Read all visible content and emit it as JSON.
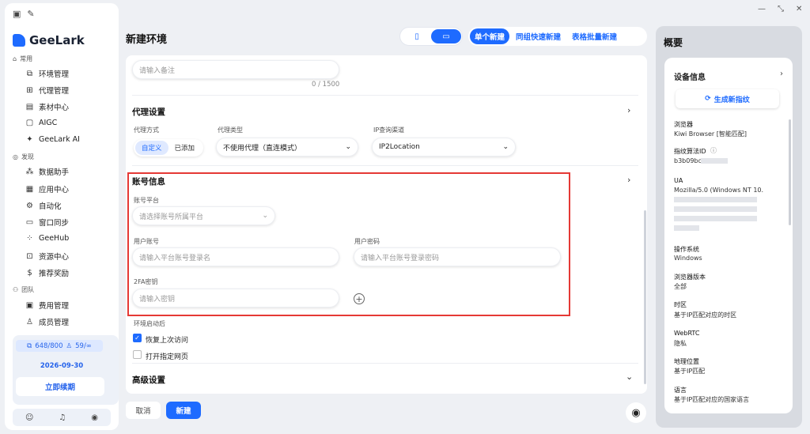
{
  "app": {
    "name": "GeeLark"
  },
  "sidebar": {
    "sections": [
      {
        "label": "常用",
        "items": [
          {
            "label": "环境管理",
            "icon": "environment-icon"
          },
          {
            "label": "代理管理",
            "icon": "proxy-icon"
          },
          {
            "label": "素材中心",
            "icon": "material-icon"
          },
          {
            "label": "AIGC",
            "icon": "aigc-icon"
          },
          {
            "label": "GeeLark AI",
            "icon": "ai-icon"
          }
        ]
      },
      {
        "label": "发现",
        "items": [
          {
            "label": "数据助手",
            "icon": "data-icon"
          },
          {
            "label": "应用中心",
            "icon": "apps-icon"
          },
          {
            "label": "自动化",
            "icon": "automation-icon"
          },
          {
            "label": "窗口同步",
            "icon": "sync-icon"
          },
          {
            "label": "GeeHub",
            "icon": "hub-icon"
          },
          {
            "label": "资源中心",
            "icon": "resource-icon"
          },
          {
            "label": "推荐奖励",
            "icon": "reward-icon"
          }
        ]
      },
      {
        "label": "团队",
        "items": [
          {
            "label": "费用管理",
            "icon": "billing-icon"
          },
          {
            "label": "成员管理",
            "icon": "members-icon"
          }
        ]
      }
    ],
    "quota": {
      "devices": "648/800",
      "members": "59/∞"
    },
    "expiry": "2026-09-30",
    "renew_label": "立即续期"
  },
  "header": {
    "title": "新建环境",
    "modes": [
      "单个新建",
      "同组快速新建",
      "表格批量新建"
    ]
  },
  "form": {
    "remark": {
      "placeholder": "请输入备注",
      "counter": "0 / 1500"
    },
    "proxy": {
      "title": "代理设置",
      "method_label": "代理方式",
      "method_options": [
        "自定义",
        "已添加"
      ],
      "type_label": "代理类型",
      "type_value": "不使用代理（直连模式）",
      "ipcheck_label": "IP查询渠道",
      "ipcheck_value": "IP2Location"
    },
    "account": {
      "title": "账号信息",
      "platform_label": "账号平台",
      "platform_placeholder": "请选择账号所属平台",
      "user_label": "用户账号",
      "user_placeholder": "请输入平台账号登录名",
      "pwd_label": "用户密码",
      "pwd_placeholder": "请输入平台账号登录密码",
      "twofa_label": "2FA密钥",
      "twofa_placeholder": "请输入密钥"
    },
    "startup": {
      "label": "环境启动后",
      "restore": "恢复上次访问",
      "open_page": "打开指定网页"
    },
    "advanced_title": "高级设置"
  },
  "footer": {
    "cancel": "取消",
    "create": "新建"
  },
  "overview": {
    "title": "概要",
    "device_info": "设备信息",
    "gen_fingerprint": "生成新指纹",
    "rows": [
      {
        "k": "浏览器",
        "v": "Kiwi Browser [智能匹配]"
      },
      {
        "k": "指纹算法ID",
        "v": "b3b09bc"
      },
      {
        "k": "UA",
        "v": "Mozilla/5.0 (Windows NT 10."
      },
      {
        "k": "操作系统",
        "v": "Windows"
      },
      {
        "k": "浏览器版本",
        "v": "全部"
      },
      {
        "k": "时区",
        "v": "基于IP匹配对应的时区"
      },
      {
        "k": "WebRTC",
        "v": "隐私"
      },
      {
        "k": "地理位置",
        "v": "基于IP匹配"
      },
      {
        "k": "语言",
        "v": "基于IP匹配对应的国家语言"
      }
    ]
  }
}
